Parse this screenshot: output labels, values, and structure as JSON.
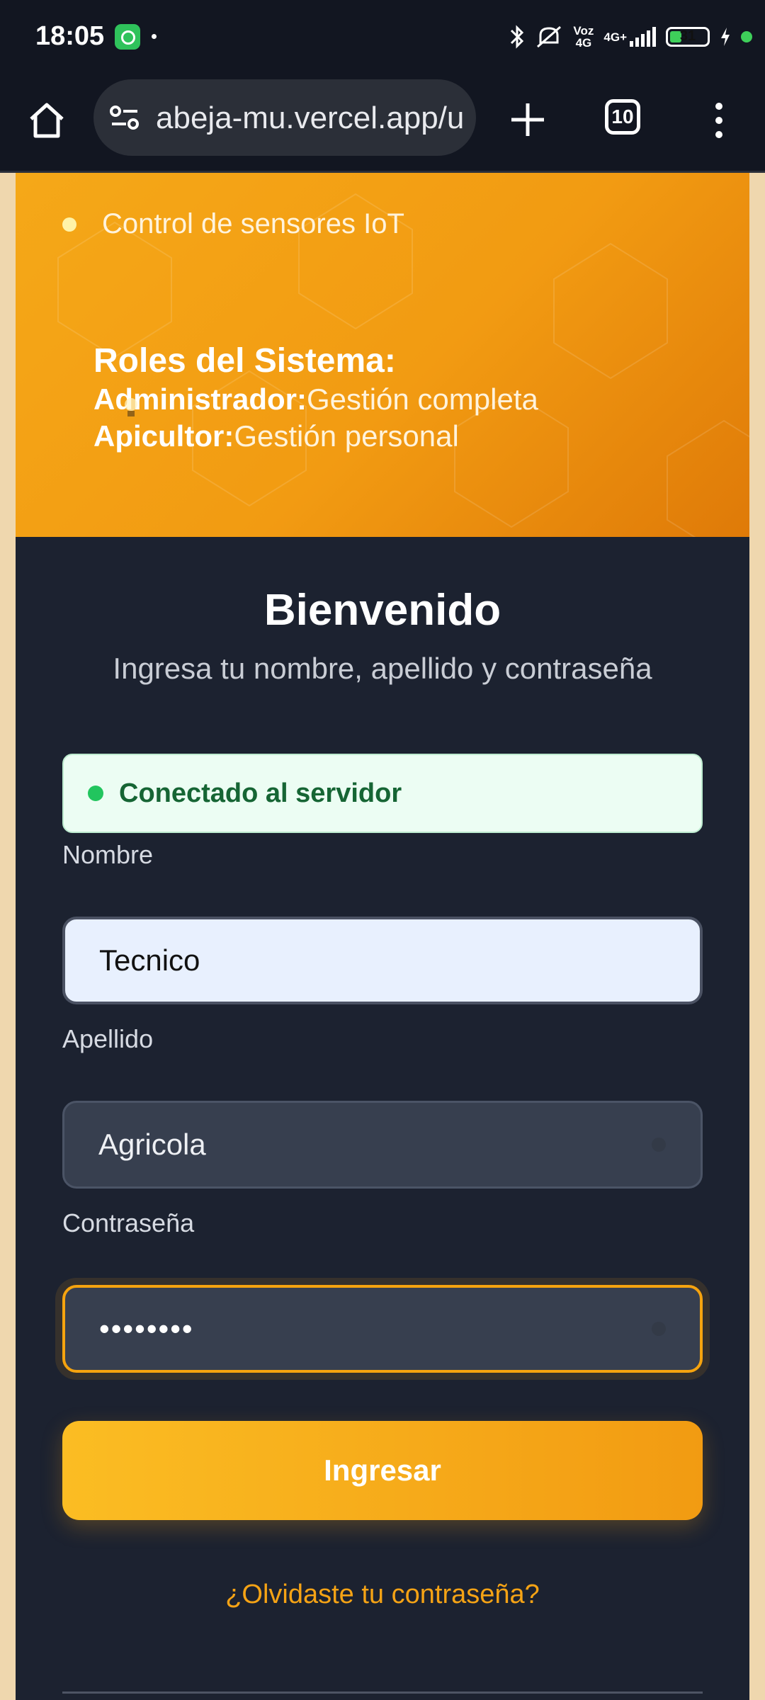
{
  "status_bar": {
    "time": "18:05",
    "network_top": "Voz",
    "network_bottom": "4G",
    "data_type": "4G+",
    "battery": "31",
    "icons": [
      "whatsapp-icon",
      "bluetooth-icon",
      "muted-vibrate-icon",
      "signal-icon",
      "battery-icon",
      "charging-icon"
    ]
  },
  "browser": {
    "url": "abeja-mu.vercel.app/u",
    "tab_count": "10"
  },
  "hero": {
    "feature": "Control de sensores IoT",
    "roles_title": "Roles del Sistema:",
    "roles": [
      {
        "name": "Administrador:",
        "desc": "Gestión completa"
      },
      {
        "name": "Apicultor:",
        "desc": "Gestión personal"
      }
    ]
  },
  "login": {
    "title": "Bienvenido",
    "subtitle": "Ingresa tu nombre, apellido y contraseña",
    "status": "Conectado al servidor",
    "nombre_label": "Nombre",
    "nombre_value": "Tecnico",
    "apellido_label": "Apellido",
    "apellido_value": "Agricola",
    "password_label": "Contraseña",
    "password_value": "••••••••",
    "submit": "Ingresar",
    "forgot": "¿Olvidaste tu contraseña?"
  },
  "colors": {
    "accent": "#f5a30f",
    "card_bg": "#1c2230",
    "success": "#22c55e"
  }
}
